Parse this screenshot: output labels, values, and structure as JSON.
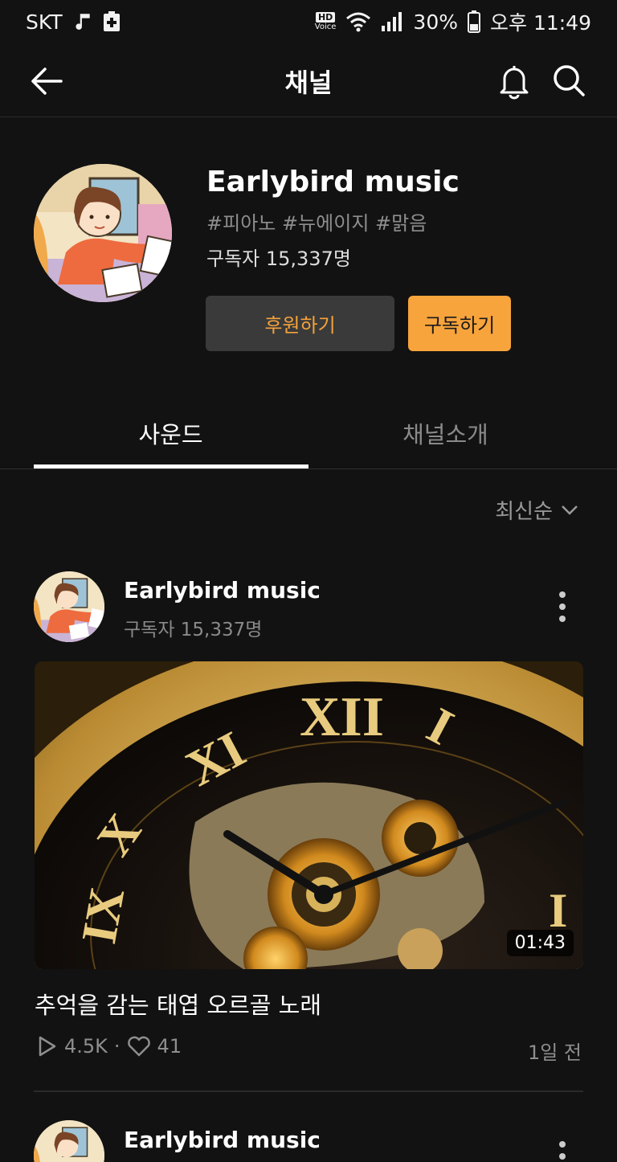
{
  "status_bar": {
    "carrier": "SKT",
    "hd": "HD",
    "voice": "Voice",
    "battery": "30%",
    "time": "오후 11:49"
  },
  "appbar": {
    "title": "채널"
  },
  "channel": {
    "name": "Earlybird music",
    "tags": "#피아노 #뉴에이지 #맑음",
    "subscribers": "구독자 15,337명",
    "support_label": "후원하기",
    "subscribe_label": "구독하기"
  },
  "tabs": [
    {
      "label": "사운드",
      "active": true
    },
    {
      "label": "채널소개",
      "active": false
    }
  ],
  "sort": {
    "label": "최신순"
  },
  "posts": [
    {
      "channel_name": "Earlybird music",
      "subscribers": "구독자 15,337명",
      "duration": "01:43",
      "title": "추억을 감는 태엽 오르골 노래",
      "plays": "4.5K",
      "separator": "·",
      "likes": "41",
      "time_ago": "1일 전"
    },
    {
      "channel_name": "Earlybird music"
    }
  ],
  "colors": {
    "background": "#121212",
    "accent": "#f8a43c",
    "support_button_bg": "#3a3a3a"
  }
}
